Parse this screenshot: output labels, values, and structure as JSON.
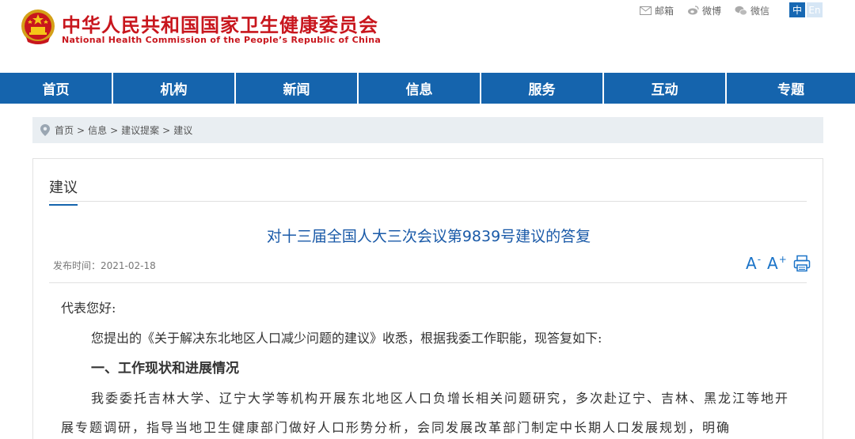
{
  "header": {
    "title_cn": "中华人民共和国国家卫生健康委员会",
    "title_en": "National Health Commission of the People’s Republic of China",
    "top_links": [
      {
        "label": "邮箱",
        "icon": "mail-icon"
      },
      {
        "label": "微博",
        "icon": "weibo-icon"
      },
      {
        "label": "微信",
        "icon": "wechat-icon"
      }
    ],
    "lang_zh": "中",
    "lang_en": "En"
  },
  "nav": {
    "items": [
      "首页",
      "机构",
      "新闻",
      "信息",
      "服务",
      "互动",
      "专题"
    ]
  },
  "breadcrumb": {
    "items": [
      "首页",
      "信息",
      "建议提案",
      "建议"
    ],
    "separator": ">"
  },
  "panel": {
    "section_tab": "建议",
    "title": "对十三届全国人大三次会议第9839号建议的答复",
    "date_label": "发布时间：",
    "date_value": "2021-02-18",
    "tools": {
      "font_smaller": "A",
      "font_smaller_sup": "-",
      "font_larger": "A",
      "font_larger_sup": "+"
    }
  },
  "article": {
    "greeting": "代表您好:",
    "intro": "您提出的《关于解决东北地区人口减少问题的建议》收悉，根据我委工作职能，现答复如下:",
    "heading1": "一、工作现状和进展情况",
    "para1": "我委委托吉林大学、辽宁大学等机构开展东北地区人口负增长相关问题研究，多次赴辽宁、吉林、黑龙江等地开展专题调研，指导当地卫生健康部门做好人口形势分析，会同发展改革部门制定中长期人口发展规划，明确"
  },
  "colors": {
    "brand_red": "#c8161d",
    "nav_blue": "#1564ad",
    "title_blue": "#1a5aa8"
  }
}
